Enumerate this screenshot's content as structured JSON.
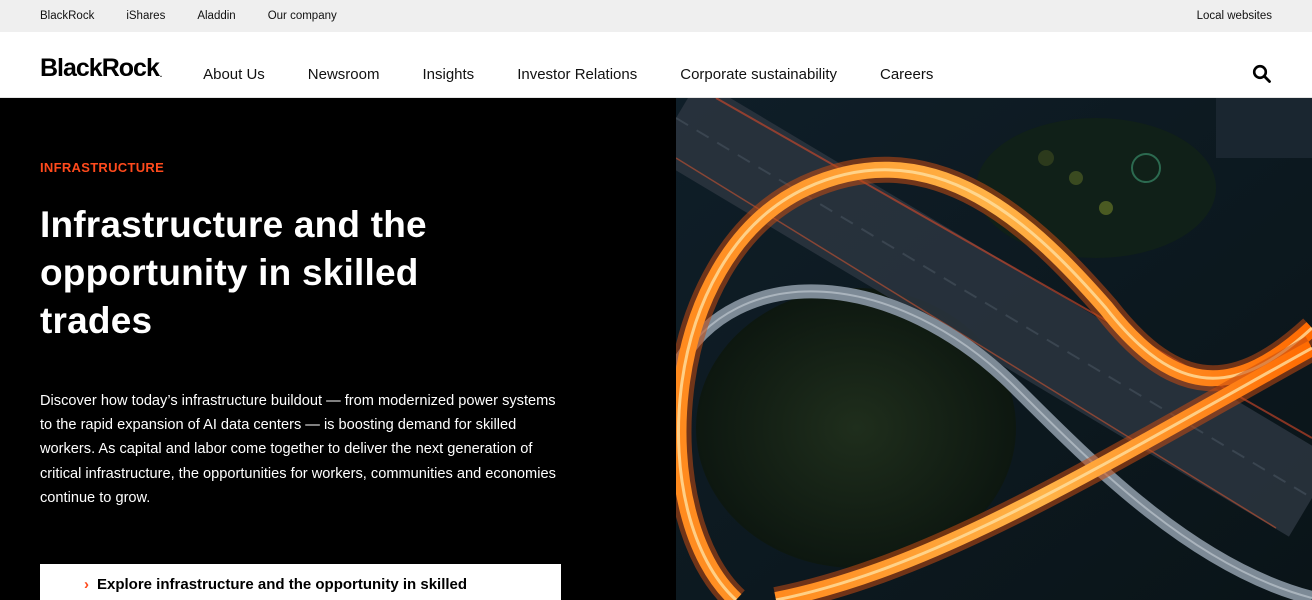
{
  "utility": {
    "links": [
      "BlackRock",
      "iShares",
      "Aladdin",
      "Our company"
    ],
    "right_link": "Local websites"
  },
  "nav": {
    "logo": "BlackRock",
    "logo_mark": ".",
    "items": [
      "About Us",
      "Newsroom",
      "Insights",
      "Investor Relations",
      "Corporate sustainability",
      "Careers"
    ],
    "search_icon": "search-icon"
  },
  "hero": {
    "eyebrow": "INFRASTRUCTURE",
    "headline": "Infrastructure and the opportunity in skilled trades",
    "body": "Discover how today’s infrastructure buildout — from modernized power systems to the rapid expansion of AI data centers — is boosting demand for skilled workers. As capital and labor come together to deliver the next generation of critical infrastructure, the opportunities for workers, communities and economies continue to grow.",
    "cta": "Explore infrastructure and the opportunity in skilled",
    "cta_icon": "chevron-right-icon"
  },
  "colors": {
    "accent": "#ff4a1c",
    "hero_bg": "#000000",
    "utility_bg": "#efefef"
  }
}
